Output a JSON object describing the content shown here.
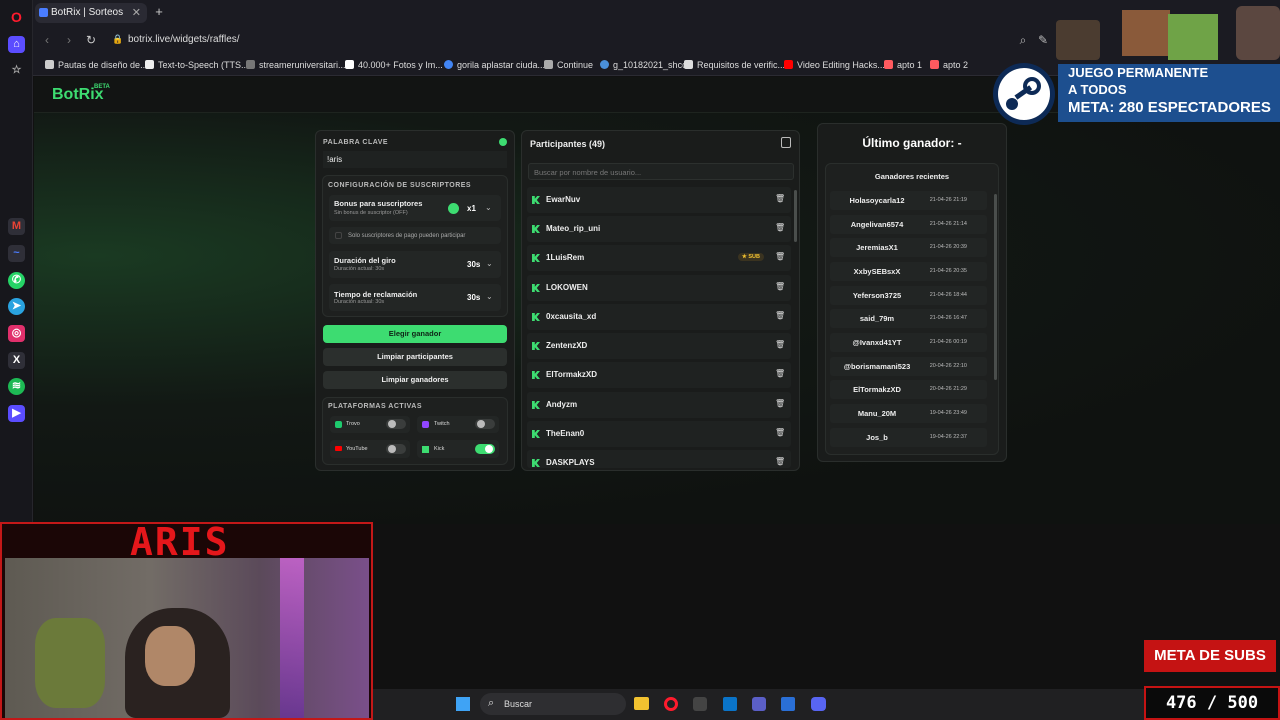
{
  "browser": {
    "tab_title": "BotRix | Sorteos",
    "url": "botrix.live/widgets/raffles/",
    "bookmarks": [
      "Pautas de diseño de...",
      "Text-to-Speech (TTS...",
      "streameruniversitari...",
      "40.000+ Fotos y Im...",
      "gorila aplastar ciuda...",
      "Continue",
      "g_10182021_shcc",
      "Requisitos de verific...",
      "Video Editing Hacks...",
      "apto 1",
      "apto 2"
    ]
  },
  "app": {
    "logo": "BotRix",
    "logo_badge": "BETA"
  },
  "left_panel": {
    "keyword_label": "PALABRA CLAVE",
    "keyword_value": "!aris",
    "subs_config_label": "CONFIGURACIÓN DE SUSCRIPTORES",
    "bonus_title": "Bonus para suscriptores",
    "bonus_sub": "Sin bonus de suscriptor (OFF)",
    "bonus_value": "x1",
    "paid_only_label": "Solo suscriptores de pago pueden participar",
    "spin_title": "Duración del giro",
    "spin_sub": "Duración actual: 30s",
    "spin_value": "30s",
    "claim_title": "Tiempo de reclamación",
    "claim_sub": "Duración actual: 30s",
    "claim_value": "30s",
    "pick_winner": "Elegir ganador",
    "clear_participants": "Limpiar participantes",
    "clear_winners": "Limpiar ganadores",
    "platforms_label": "PLATAFORMAS ACTIVAS",
    "platforms": [
      {
        "name": "Trovo",
        "on": false
      },
      {
        "name": "Twitch",
        "on": false
      },
      {
        "name": "YouTube",
        "on": false
      },
      {
        "name": "Kick",
        "on": true
      }
    ]
  },
  "participants": {
    "title": "Participantes (49)",
    "search_placeholder": "Buscar por nombre de usuario...",
    "sub_badge": "SUB",
    "list": [
      "EwarNuv",
      "Mateo_rip_uni",
      "1LuisRem",
      "LOKOWEN",
      "0xcausita_xd",
      "ZentenzXD",
      "ElTormakzXD",
      "Andyzm",
      "TheEnan0",
      "DASKPLAYS"
    ]
  },
  "winners": {
    "last_winner": "Último ganador: -",
    "recent_label": "Ganadores recientes",
    "list": [
      {
        "name": "Holasoycarla12",
        "date": "21-04-26 21:19"
      },
      {
        "name": "Angelivan6574",
        "date": "21-04-26 21:14"
      },
      {
        "name": "JeremiasX1",
        "date": "21-04-26 20:39"
      },
      {
        "name": "XxbySEBsxX",
        "date": "21-04-26 20:35"
      },
      {
        "name": "Yeferson3725",
        "date": "21-04-26 18:44"
      },
      {
        "name": "said_79m",
        "date": "21-04-26 16:47"
      },
      {
        "name": "@Ivanxd41YT",
        "date": "21-04-26 00:19"
      },
      {
        "name": "@borismamani523",
        "date": "20-04-26 22:10"
      },
      {
        "name": "ElTormakzXD",
        "date": "20-04-26 21:29"
      },
      {
        "name": "Manu_20M",
        "date": "19-04-26 23:49"
      },
      {
        "name": "Jos_b",
        "date": "19-04-26 22:37"
      }
    ]
  },
  "overlays": {
    "steam_line1": "JUEGO PERMANENTE",
    "steam_line2": "A TODOS",
    "steam_line3_prefix": "META:",
    "steam_line3_value": "280 ESPECTADORES",
    "streamer_name": "ARIS",
    "subs_goal_label": "META DE SUBS",
    "subs_goal_value": "476 / 500"
  },
  "taskbar": {
    "search_placeholder": "Buscar"
  }
}
